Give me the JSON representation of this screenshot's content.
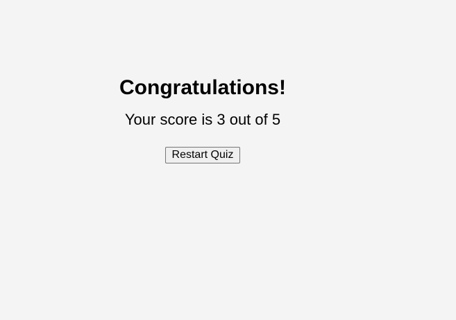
{
  "result": {
    "title": "Congratulations!",
    "score_text": "Your score is 3 out of 5",
    "restart_label": "Restart Quiz"
  }
}
